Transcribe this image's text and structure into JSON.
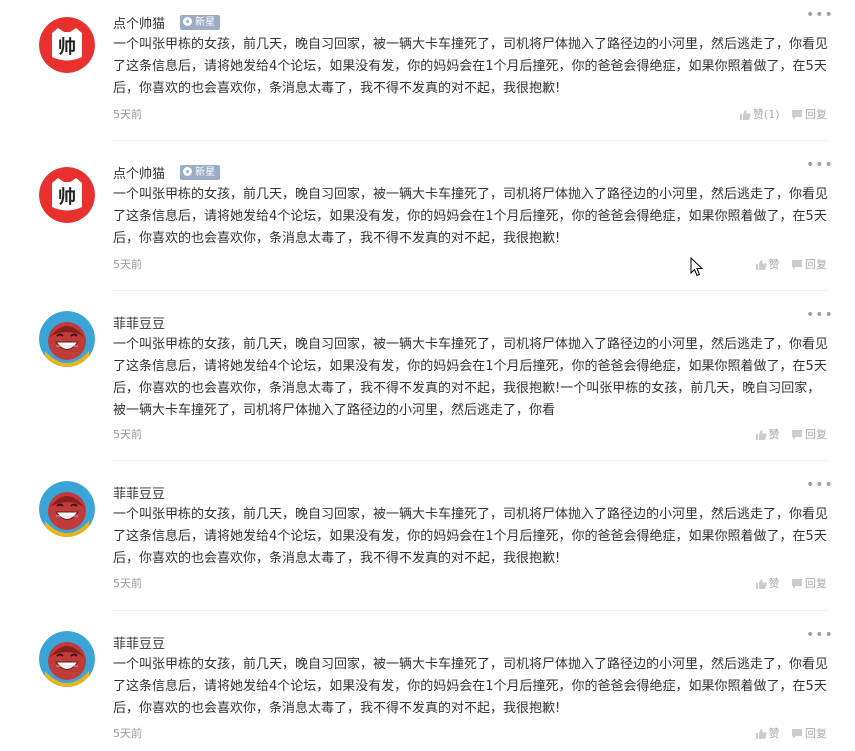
{
  "comments": [
    {
      "username": "点个帅猫",
      "badge": "新星",
      "avatar_type": "cat",
      "text": "一个叫张甲栋的女孩，前几天，晚自习回家，被一辆大卡车撞死了，司机将尸体抛入了路径边的小河里，然后逃走了，你看见了这条信息后，请将她发给4个论坛，如果没有发，你的妈妈会在1个月后撞死，你的爸爸会得绝症，如果你照着做了，在5天后，你喜欢的也会喜欢你，条消息太毒了，我不得不发真的对不起，我很抱歉!",
      "time": "5天前",
      "like_label": "赞(1)",
      "reply_label": "回复"
    },
    {
      "username": "点个帅猫",
      "badge": "新星",
      "avatar_type": "cat",
      "text": "一个叫张甲栋的女孩，前几天，晚自习回家，被一辆大卡车撞死了，司机将尸体抛入了路径边的小河里，然后逃走了，你看见了这条信息后，请将她发给4个论坛，如果没有发，你的妈妈会在1个月后撞死，你的爸爸会得绝症，如果你照着做了，在5天后，你喜欢的也会喜欢你，条消息太毒了，我不得不发真的对不起，我很抱歉!",
      "time": "5天前",
      "like_label": "赞",
      "reply_label": "回复"
    },
    {
      "username": "菲菲豆豆",
      "badge": "",
      "avatar_type": "face",
      "text": "一个叫张甲栋的女孩，前几天，晚自习回家，被一辆大卡车撞死了，司机将尸体抛入了路径边的小河里，然后逃走了，你看见了这条信息后，请将她发给4个论坛，如果没有发，你的妈妈会在1个月后撞死，你的爸爸会得绝症，如果你照着做了，在5天后，你喜欢的也会喜欢你，条消息太毒了，我不得不发真的对不起，我很抱歉!一个叫张甲栋的女孩，前几天，晚自习回家，被一辆大卡车撞死了，司机将尸体抛入了路径边的小河里，然后逃走了，你看",
      "time": "5天前",
      "like_label": "赞",
      "reply_label": "回复"
    },
    {
      "username": "菲菲豆豆",
      "badge": "",
      "avatar_type": "face",
      "text": "一个叫张甲栋的女孩，前几天，晚自习回家，被一辆大卡车撞死了，司机将尸体抛入了路径边的小河里，然后逃走了，你看见了这条信息后，请将她发给4个论坛，如果没有发，你的妈妈会在1个月后撞死，你的爸爸会得绝症，如果你照着做了，在5天后，你喜欢的也会喜欢你，条消息太毒了，我不得不发真的对不起，我很抱歉!",
      "time": "5天前",
      "like_label": "赞",
      "reply_label": "回复"
    },
    {
      "username": "菲菲豆豆",
      "badge": "",
      "avatar_type": "face",
      "text": "一个叫张甲栋的女孩，前几天，晚自习回家，被一辆大卡车撞死了，司机将尸体抛入了路径边的小河里，然后逃走了，你看见了这条信息后，请将她发给4个论坛，如果没有发，你的妈妈会在1个月后撞死，你的爸爸会得绝症，如果你照着做了，在5天后，你喜欢的也会喜欢你，条消息太毒了，我不得不发真的对不起，我很抱歉!",
      "time": "5天前",
      "like_label": "赞",
      "reply_label": "回复"
    }
  ],
  "cat_avatar_glyph": "帅",
  "more_glyph": "•••",
  "colors": {
    "cat_avatar_red": "#e8312f",
    "badge_bg": "#9aacc6",
    "muted": "#999999",
    "divider": "#efefef"
  }
}
